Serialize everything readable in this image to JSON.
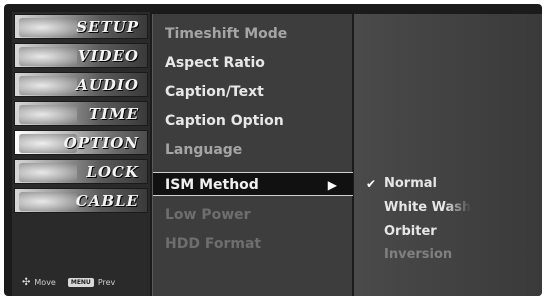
{
  "sidebar": {
    "items": [
      {
        "label": "SETUP",
        "icon": "setup-icon"
      },
      {
        "label": "VIDEO",
        "icon": "video-icon"
      },
      {
        "label": "AUDIO",
        "icon": "audio-icon"
      },
      {
        "label": "TIME",
        "icon": "time-icon"
      },
      {
        "label": "OPTION",
        "icon": "option-icon"
      },
      {
        "label": "LOCK",
        "icon": "lock-icon"
      },
      {
        "label": "CABLE",
        "icon": "cable-icon"
      }
    ],
    "footer": {
      "move_icon": "✣",
      "move_label": "Move",
      "menu_key": "MENU",
      "prev_label": "Prev"
    }
  },
  "submenu": {
    "items": [
      {
        "label": "Timeshift Mode"
      },
      {
        "label": "Aspect Ratio"
      },
      {
        "label": "Caption/Text"
      },
      {
        "label": "Caption Option"
      },
      {
        "label": "Language"
      },
      {
        "label": "ISM Method",
        "arrow": "▶"
      },
      {
        "label": "Low Power"
      },
      {
        "label": "HDD Format"
      }
    ]
  },
  "options": {
    "check": "✔",
    "items": [
      {
        "label": "Normal"
      },
      {
        "label": "White Wash"
      },
      {
        "label": "Orbiter"
      },
      {
        "label": "Inversion"
      }
    ]
  }
}
